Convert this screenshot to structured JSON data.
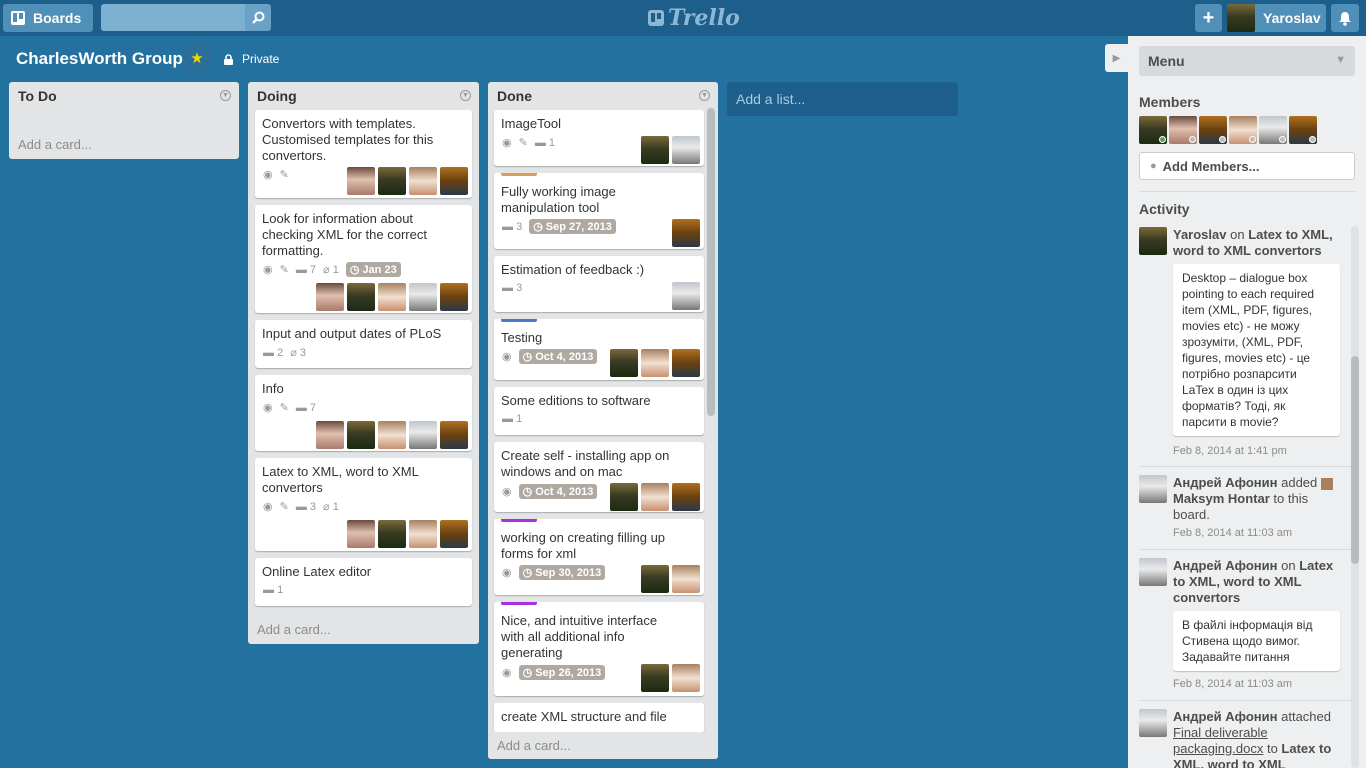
{
  "header": {
    "boards_label": "Boards",
    "search_placeholder": "",
    "logo_text": "Trello",
    "add_label": "+",
    "user_name": "Yaroslav"
  },
  "board": {
    "title": "CharlesWorth Group",
    "star": "★",
    "privacy": "Private"
  },
  "lists": {
    "todo": {
      "title": "To Do",
      "add_card": "Add a card..."
    },
    "doing": {
      "title": "Doing",
      "add_card": "Add a card...",
      "cards": [
        {
          "title": "Convertors with templates. Customised templates for this convertors.",
          "comments": "",
          "attachments": ""
        },
        {
          "title": "Look for information about checking XML for the correct formatting.",
          "comments": "7",
          "attachments": "1",
          "due": "Jan 23"
        },
        {
          "title": "Input and output dates of PLoS",
          "comments": "2",
          "attachments": "3"
        },
        {
          "title": "Info",
          "comments": "7"
        },
        {
          "title": "Latex to XML, word to XML convertors",
          "comments": "3",
          "attachments": "1"
        },
        {
          "title": "Online Latex editor",
          "comments": "1"
        }
      ]
    },
    "done": {
      "title": "Done",
      "add_card": "Add a card...",
      "cards": [
        {
          "title": "ImageTool",
          "comments": "1"
        },
        {
          "title": "Fully working image manipulation tool",
          "comments": "3",
          "due": "Sep 27, 2013",
          "label_color": "#e09b55"
        },
        {
          "title": "Estimation of feedback :)",
          "comments": "3"
        },
        {
          "title": "Testing",
          "due": "Oct 4, 2013",
          "label_color": "#4d77cb"
        },
        {
          "title": "Some editions to software",
          "comments": "1"
        },
        {
          "title": "Create self - installing app on windows and on mac",
          "due": "Oct 4, 2013"
        },
        {
          "title": "working on creating filling up forms for xml",
          "due": "Sep 30, 2013",
          "label_color": "#a632db"
        },
        {
          "title": "Nice, and intuitive interface with all additional info generating",
          "due": "Sep 26, 2013",
          "label_color": "#a632db"
        },
        {
          "title": "create XML structure and file"
        }
      ]
    },
    "add_list": "Add a list..."
  },
  "sidebar": {
    "menu_label": "Menu",
    "members_heading": "Members",
    "add_members": "Add Members...",
    "activity_heading": "Activity",
    "activity": [
      {
        "author": "Yaroslav",
        "verb": " on ",
        "target": "Latex to XML, word to XML convertors",
        "comment": "Desktop – dialogue box pointing to each required item (XML, PDF, figures, movies etc) - не можу зрозуміти, (XML, PDF, figures, movies etc) - це потрібно розпарсити LaTex в один із цих форматів? Тоді, як парсити в movie?",
        "time": "Feb 8, 2014 at 1:41 pm"
      },
      {
        "author": "Андрей Афонин",
        "verb": " added ",
        "target": "Maksym Hontar",
        "suffix": " to this board.",
        "time": "Feb 8, 2014 at 11:03 am"
      },
      {
        "author": "Андрей Афонин",
        "verb": " on ",
        "target": "Latex to XML, word to XML convertors",
        "comment": "В файлі інформація від Стивена щодо вимог. Задавайте питання",
        "time": "Feb 8, 2014 at 11:03 am"
      },
      {
        "author": "Андрей Афонин",
        "verb": " attached ",
        "link": "Final deliverable packaging.docx",
        "mid": " to ",
        "target": "Latex to XML, word to XML"
      }
    ]
  }
}
